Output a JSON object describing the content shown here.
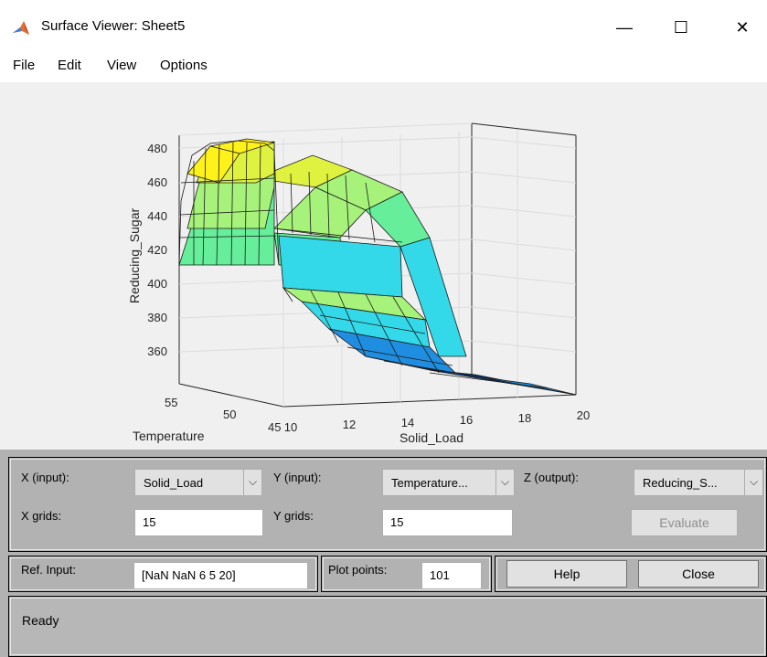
{
  "window": {
    "title": "Surface Viewer: Sheet5",
    "minimize_glyph": "—",
    "maximize_glyph": "☐",
    "close_glyph": "✕"
  },
  "menu": {
    "items": [
      {
        "label": "File"
      },
      {
        "label": "Edit"
      },
      {
        "label": "View"
      },
      {
        "label": "Options"
      }
    ]
  },
  "plot": {
    "z_label": "Reducing_Sugar",
    "z_ticks": [
      "480",
      "460",
      "440",
      "420",
      "400",
      "380",
      "360"
    ],
    "y_label": "Temperature",
    "y_ticks": [
      "55",
      "50",
      "45"
    ],
    "x_label": "Solid_Load",
    "x_ticks": [
      "10",
      "12",
      "14",
      "16",
      "18",
      "20"
    ],
    "colormap": [
      "#0a4aa8",
      "#1f8ee0",
      "#33d9e8",
      "#66ee9a",
      "#a6f27a",
      "#dff23f",
      "#fff21a"
    ]
  },
  "controls": {
    "x_input_label": "X (input):",
    "x_input_value": "Solid_Load",
    "y_input_label": "Y (input):",
    "y_input_value": "Temperature...",
    "z_output_label": "Z (output):",
    "z_output_value": "Reducing_S...",
    "x_grids_label": "X grids:",
    "x_grids_value": "15",
    "y_grids_label": "Y grids:",
    "y_grids_value": "15",
    "evaluate_label": "Evaluate",
    "ref_input_label": "Ref. Input:",
    "ref_input_value": "[NaN NaN 6 5 20]",
    "plot_points_label": "Plot points:",
    "plot_points_value": "101",
    "help_label": "Help",
    "close_label": "Close",
    "dropdown_arrow": "⌵"
  },
  "status": {
    "text": "Ready"
  }
}
